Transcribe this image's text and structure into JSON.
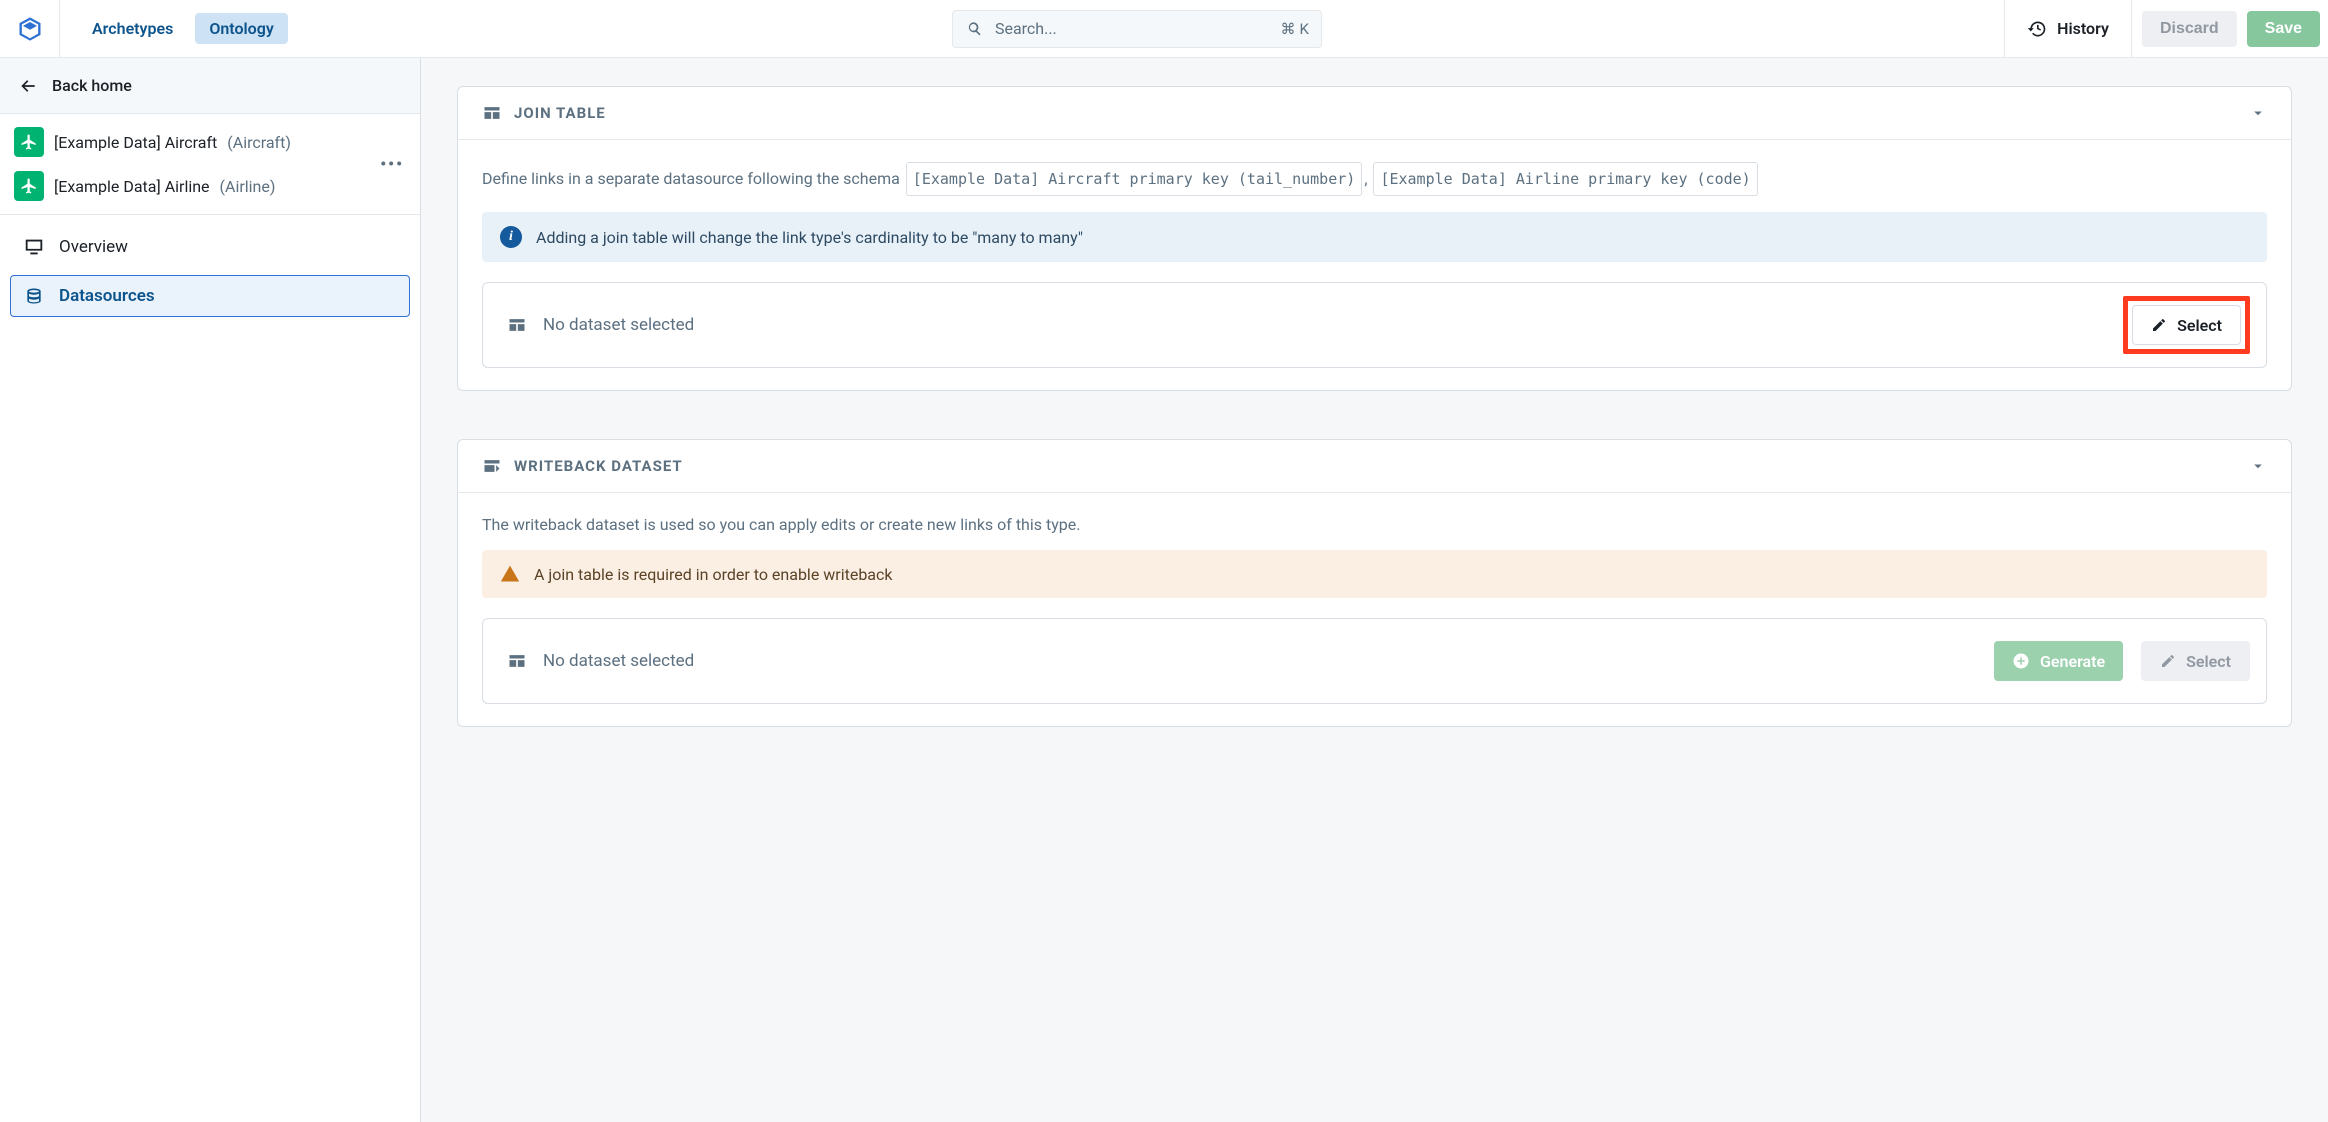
{
  "tabs": {
    "archetypes": "Archetypes",
    "ontology": "Ontology"
  },
  "search": {
    "placeholder": "Search...",
    "shortcut_sym": "⌘",
    "shortcut_key": "K"
  },
  "top_actions": {
    "history": "History",
    "discard": "Discard",
    "save": "Save"
  },
  "sidebar": {
    "back": "Back home",
    "objects": [
      {
        "name": "[Example Data] Aircraft",
        "api": "(Aircraft)"
      },
      {
        "name": "[Example Data] Airline",
        "api": "(Airline)"
      }
    ],
    "nav": {
      "overview": "Overview",
      "datasources": "Datasources"
    }
  },
  "join": {
    "section_title": "JOIN TABLE",
    "lead": "Define links in a separate datasource following the schema",
    "schema1": "[Example Data] Aircraft primary key (tail_number)",
    "schema2": "[Example Data] Airline primary key (code)",
    "comma": ",",
    "info": "Adding a join table will change the link type's cardinality to be \"many to many\"",
    "no_dataset": "No dataset selected",
    "select": "Select"
  },
  "writeback": {
    "section_title": "WRITEBACK DATASET",
    "desc": "The writeback dataset is used so you can apply edits or create new links of this type.",
    "warn": "A join table is required in order to enable writeback",
    "no_dataset": "No dataset selected",
    "generate": "Generate",
    "select": "Select"
  }
}
